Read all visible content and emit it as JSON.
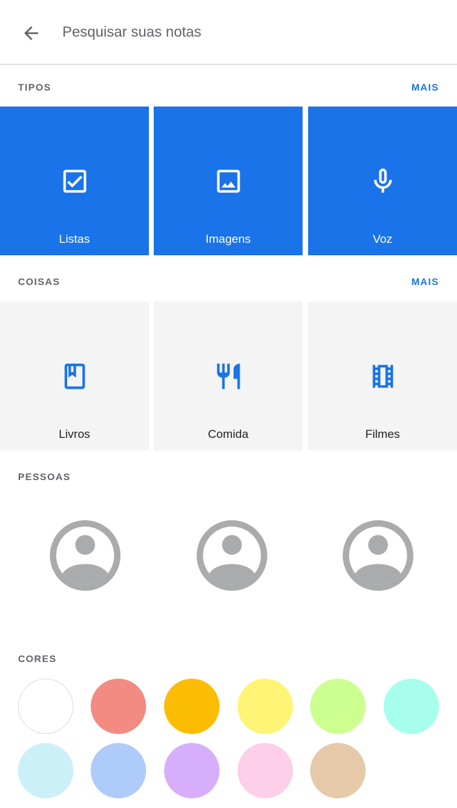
{
  "search": {
    "placeholder": "Pesquisar suas notas"
  },
  "icons": {
    "back": "arrow-back-icon"
  },
  "sections": {
    "tipos": {
      "title": "TIPOS",
      "more": "MAIS"
    },
    "coisas": {
      "title": "COISAS",
      "more": "MAIS"
    },
    "pessoas": {
      "title": "PESSOAS"
    },
    "cores": {
      "title": "CORES"
    }
  },
  "tipos": [
    {
      "label": "Listas",
      "icon": "checkbox-icon"
    },
    {
      "label": "Imagens",
      "icon": "image-icon"
    },
    {
      "label": "Voz",
      "icon": "microphone-icon"
    }
  ],
  "coisas": [
    {
      "label": "Livros",
      "icon": "book-icon"
    },
    {
      "label": "Comida",
      "icon": "restaurant-icon"
    },
    {
      "label": "Filmes",
      "icon": "movie-icon"
    }
  ],
  "pessoas": [
    {
      "icon": "person-avatar-icon"
    },
    {
      "icon": "person-avatar-icon"
    },
    {
      "icon": "person-avatar-icon"
    }
  ],
  "colors": {
    "accent": "#1a73e8",
    "swatches": [
      "#ffffff",
      "#f28b82",
      "#fbbc04",
      "#fff475",
      "#ccff90",
      "#a7ffeb",
      "#cbf0f8",
      "#aecbfa",
      "#d7aefb",
      "#fdcfe8",
      "#e6c9a8"
    ]
  }
}
